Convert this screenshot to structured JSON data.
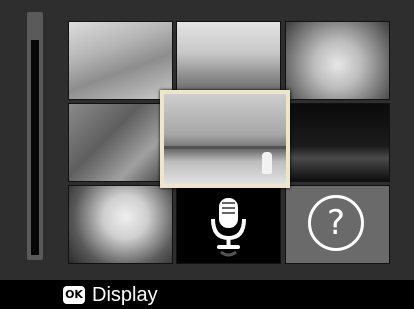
{
  "thumbnails": [
    {
      "name": "photo-thumbnail-1"
    },
    {
      "name": "photo-thumbnail-2"
    },
    {
      "name": "photo-thumbnail-3"
    },
    {
      "name": "photo-thumbnail-4"
    },
    {
      "name": "photo-thumbnail-selected"
    },
    {
      "name": "photo-thumbnail-6"
    },
    {
      "name": "photo-thumbnail-7"
    },
    {
      "name": "voice-memo-thumbnail",
      "icon": "microphone-icon"
    },
    {
      "name": "unknown-file-thumbnail",
      "icon": "question-mark-icon"
    }
  ],
  "help_glyph": "?",
  "footer": {
    "ok_badge": "OK",
    "action_label": "Display"
  },
  "colors": {
    "selection_border": "#efe6c7",
    "bottom_bar": "#000000",
    "background": "#2e2e2e"
  }
}
